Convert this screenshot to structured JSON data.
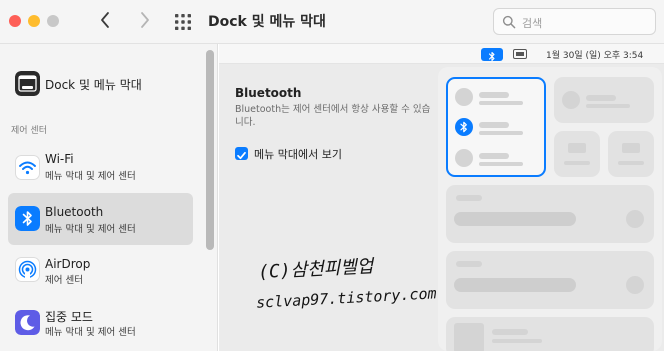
{
  "window": {
    "title": "Dock 및 메뉴 막대",
    "search_placeholder": "검색"
  },
  "sidebar": {
    "top_item": {
      "label": "Dock 및 메뉴 막대",
      "icon": "dock-icon"
    },
    "section_label": "제어 센터",
    "items": [
      {
        "label": "Wi-Fi",
        "sub": "메뉴 막대 및 제어 센터",
        "icon": "wifi-icon",
        "color": "#ffffff",
        "selected": false
      },
      {
        "label": "Bluetooth",
        "sub": "메뉴 막대 및 제어 센터",
        "icon": "bluetooth-icon",
        "color": "#0a7cff",
        "selected": true
      },
      {
        "label": "AirDrop",
        "sub": "제어 센터",
        "icon": "airdrop-icon",
        "color": "#ffffff",
        "selected": false
      },
      {
        "label": "집중 모드",
        "sub": "메뉴 막대 및 제어 센터",
        "icon": "moon-icon",
        "color": "#5e5ce6",
        "selected": false
      }
    ]
  },
  "menubar_preview": {
    "clock": "1월 30일 (일) 오후  3:54"
  },
  "content": {
    "title": "Bluetooth",
    "description": "Bluetooth는 제어 센터에서 항상 사용할 수 있습니다.",
    "checkbox_label": "메뉴 막대에서 보기",
    "checkbox_checked": true
  },
  "watermark": {
    "line1": "(C)삼천피벨업",
    "line2": "sclvap97.tistory.com"
  },
  "colors": {
    "accent": "#0a7cff",
    "close": "#fe5f57",
    "minimize": "#febc2e",
    "zoom": "#c8c8c8"
  }
}
